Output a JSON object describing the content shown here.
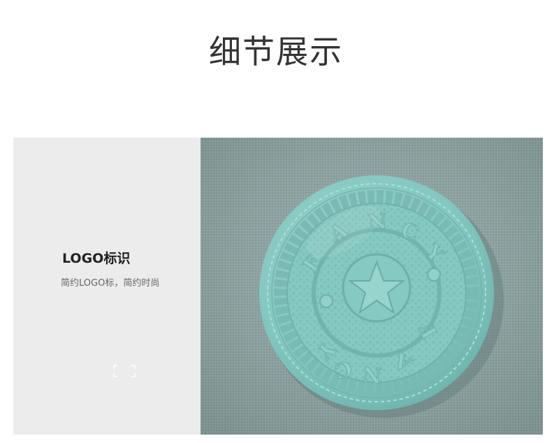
{
  "header": {
    "title": "细节展示"
  },
  "feature": {
    "title": "LOGO标识",
    "description": "简约LOGO标，简约时尚",
    "frame_icon": "corner-frame-icon"
  },
  "photo": {
    "subject": "logo-patch-photo",
    "patch_text_top": "FANCY",
    "patch_text_bottom": "FANCY",
    "colors": {
      "fabric": "#8fa8a6",
      "patch": "#86c9c3",
      "panel": "#ececec"
    }
  }
}
